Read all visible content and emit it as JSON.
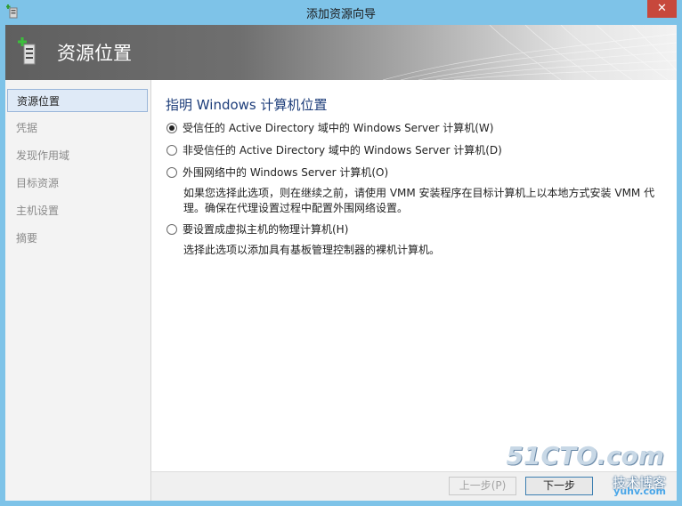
{
  "window": {
    "title": "添加资源向导",
    "close_glyph": "✕"
  },
  "banner": {
    "title": "资源位置",
    "icon": "add-server-icon"
  },
  "nav": {
    "items": [
      {
        "label": "资源位置",
        "active": true
      },
      {
        "label": "凭据",
        "active": false
      },
      {
        "label": "发现作用域",
        "active": false
      },
      {
        "label": "目标资源",
        "active": false
      },
      {
        "label": "主机设置",
        "active": false
      },
      {
        "label": "摘要",
        "active": false
      }
    ]
  },
  "main": {
    "heading": "指明 Windows 计算机位置",
    "options": [
      {
        "label": "受信任的 Active Directory 域中的 Windows Server 计算机(W)",
        "selected": true
      },
      {
        "label": "非受信任的 Active Directory 域中的 Windows Server 计算机(D)",
        "selected": false
      },
      {
        "label": "外围网络中的 Windows Server 计算机(O)",
        "selected": false,
        "description_line1": "如果您选择此选项，则在继续之前，请使用 VMM 安装程序在目标计算机上以本地方式安装 VMM 代",
        "description_line2": "理。确保在代理设置过程中配置外围网络设置。"
      },
      {
        "label": "要设置成虚拟主机的物理计算机(H)",
        "selected": false,
        "description_line1": "选择此选项以添加具有基板管理控制器的裸机计算机。"
      }
    ]
  },
  "footer": {
    "prev_label": "上一步(P)",
    "next_label": "下一步"
  },
  "watermark": {
    "main": "51CTO.com",
    "sub": "技术博客",
    "site": "yuhv.com"
  },
  "colors": {
    "title_bar": "#7ec3e8",
    "close_button": "#c7483c",
    "heading": "#1d3d7a",
    "nav_active_bg": "#dfeaf7"
  }
}
